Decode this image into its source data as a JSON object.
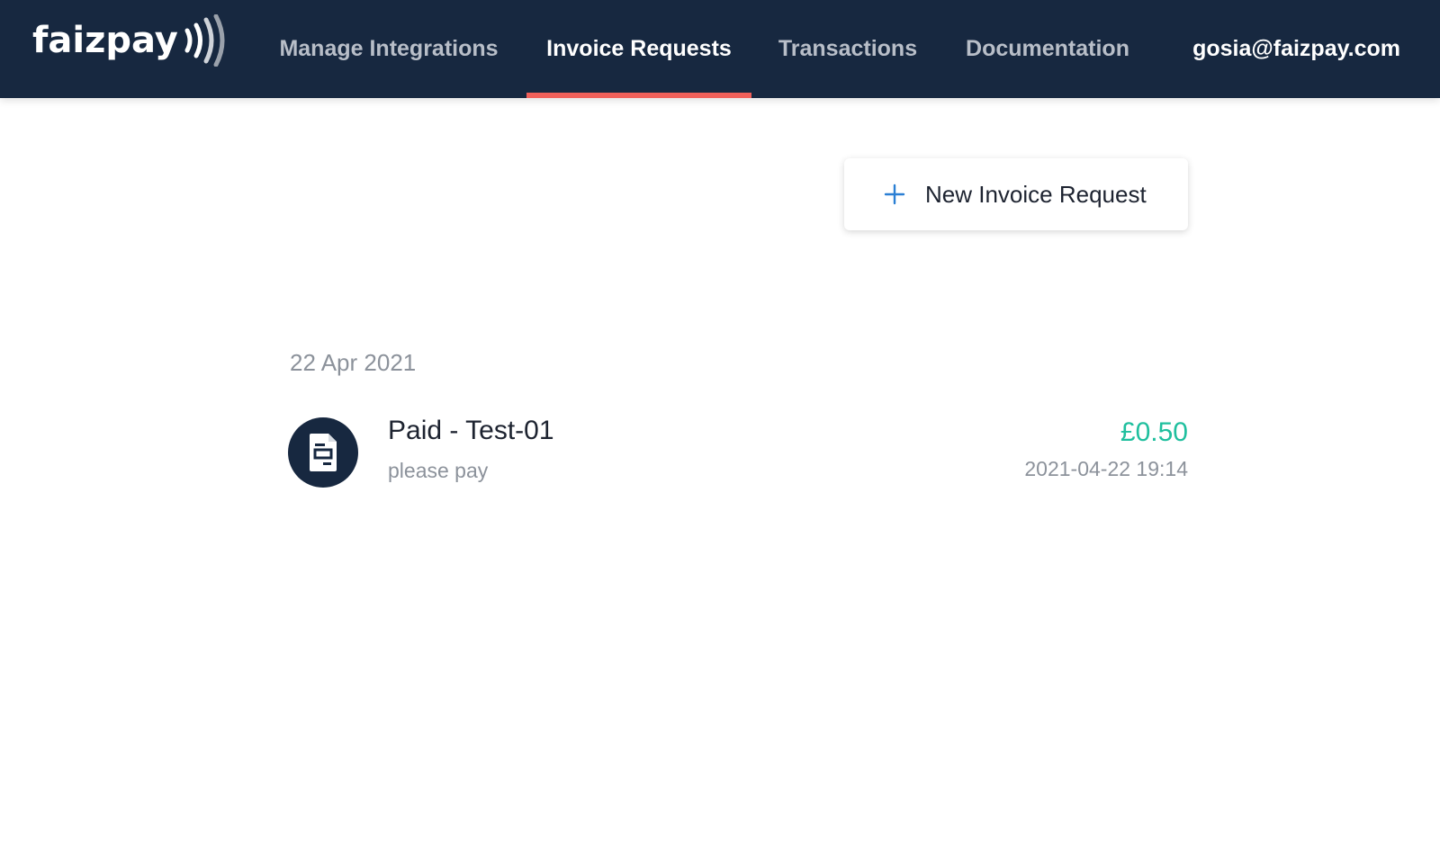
{
  "brand": {
    "name": "faizpay",
    "colors": {
      "navbar_bg": "#172840",
      "active_underline": "#f0605a",
      "amount_green": "#1fbf9e",
      "plus_blue": "#2b7fd4"
    }
  },
  "nav": {
    "items": [
      {
        "label": "Manage Integrations",
        "active": false
      },
      {
        "label": "Invoice Requests",
        "active": true
      },
      {
        "label": "Transactions",
        "active": false
      },
      {
        "label": "Documentation",
        "active": false
      }
    ],
    "user_email": "gosia@faizpay.com"
  },
  "toolbar": {
    "new_invoice_label": "New Invoice Request",
    "new_invoice_icon": "plus-icon"
  },
  "groups": [
    {
      "date": "22 Apr 2021",
      "items": [
        {
          "icon": "document-icon",
          "title": "Paid - Test-01",
          "description": "please pay",
          "amount": "£0.50",
          "timestamp": "2021-04-22 19:14"
        }
      ]
    }
  ]
}
